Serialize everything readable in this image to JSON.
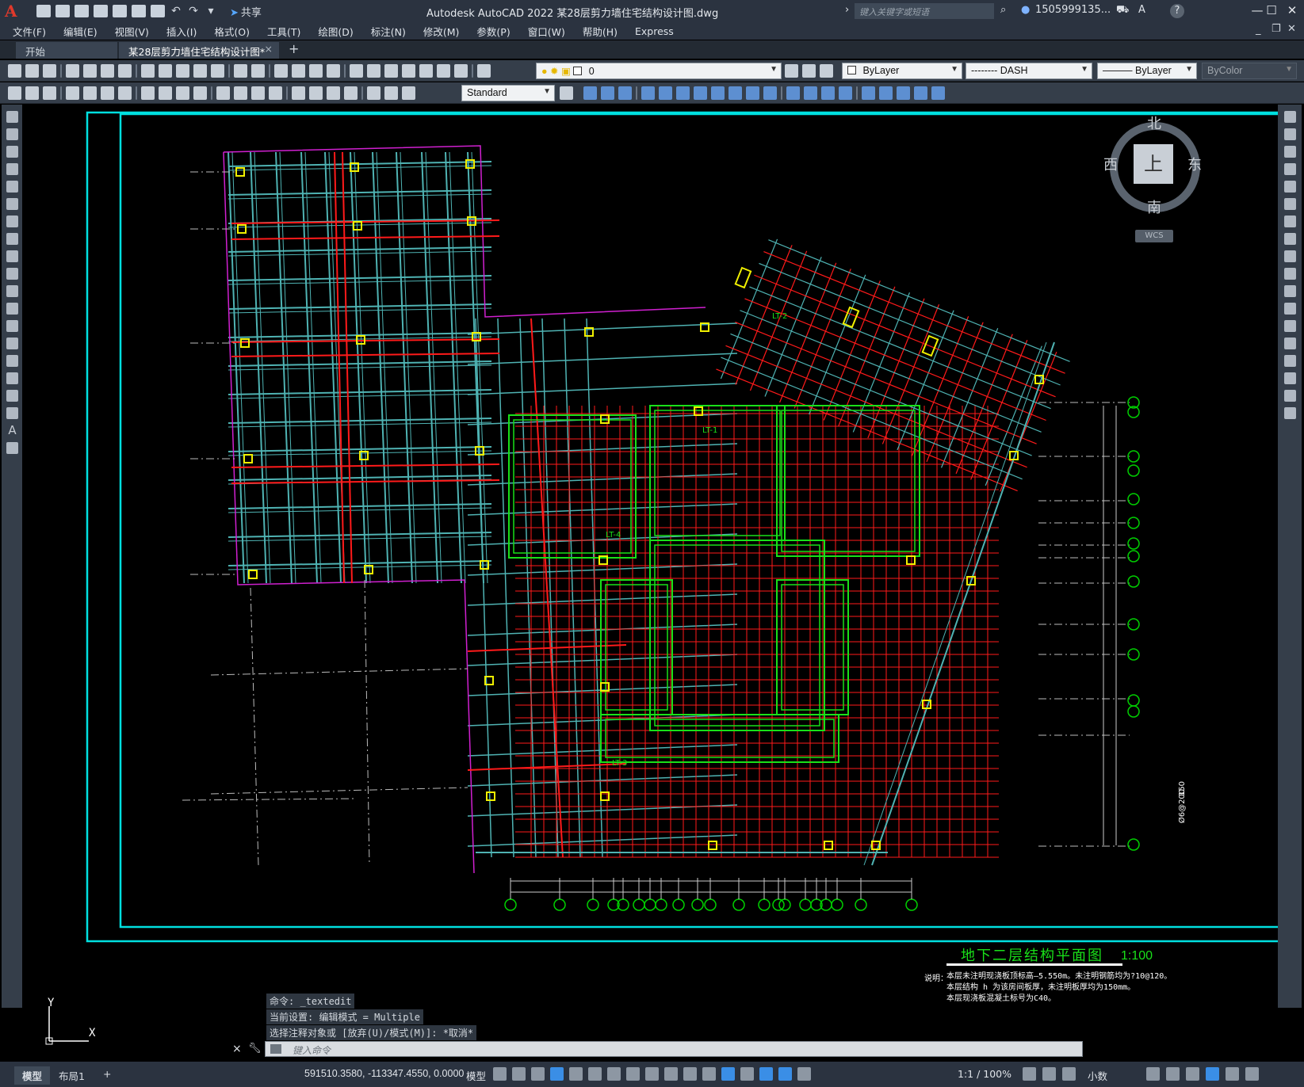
{
  "app": {
    "logo": "A",
    "title": "Autodesk AutoCAD 2022    某28层剪力墙住宅结构设计图.dwg",
    "share_label": "共享",
    "search_placeholder": "键入关键字或短语",
    "user": "1505999135...",
    "help": "?"
  },
  "menu": [
    "文件(F)",
    "编辑(E)",
    "视图(V)",
    "插入(I)",
    "格式(O)",
    "工具(T)",
    "绘图(D)",
    "标注(N)",
    "修改(M)",
    "参数(P)",
    "窗口(W)",
    "帮助(H)",
    "Express"
  ],
  "tabs": {
    "start": "开始",
    "active": "某28层剪力墙住宅结构设计图*",
    "close": "×",
    "add": "+"
  },
  "toolbar": {
    "layer_value": "0",
    "color_value": "ByLayer",
    "linetype_value": "-------- DASH",
    "lineweight_value": "ByLayer",
    "plotstyle_value": "ByColor",
    "textstyle_value": "Standard"
  },
  "viewcube": {
    "north": "北",
    "south": "南",
    "east": "东",
    "west": "西",
    "top": "上",
    "wcs": "WCS"
  },
  "drawing": {
    "title": "地下二层结构平面图",
    "scale": "1:100",
    "note_label": "说明：",
    "notes": [
      "本层未注明现浇板顶标高—5.550m。未注明钢筋均为?10@120。",
      "本层结构 h 为该房间板厚，未注明板厚均为150mm。",
      "本层现浇板混凝土标号为C40。"
    ],
    "stair_labels": [
      "LT-1",
      "LT-2",
      "LT-3",
      "LT-4"
    ],
    "side_dims": [
      "150",
      "Ø6@200"
    ]
  },
  "command": {
    "history": [
      "命令: _textedit",
      "当前设置: 编辑模式 = Multiple",
      "选择注释对象或 [放弃(U)/模式(M)]: *取消*"
    ],
    "prompt": "键入命令",
    "close": "×"
  },
  "ucs": {
    "x": "X",
    "y": "Y"
  },
  "status": {
    "layout_tabs": [
      "模型",
      "布局1"
    ],
    "add_layout": "+",
    "coordinates": "591510.3580, -113347.4550, 0.0000",
    "mode": "模型",
    "annotation_scale": "1:1 / 100%",
    "units": "小数"
  },
  "colors": {
    "frame_cyan": "#00e0e0",
    "grid_teal": "#4fb3b3",
    "rebar_red": "#ff1a1a",
    "wall_green": "#19e019",
    "column_yellow": "#f0f000",
    "boundary_magenta": "#d020d0",
    "axis_green": "#00d000"
  }
}
